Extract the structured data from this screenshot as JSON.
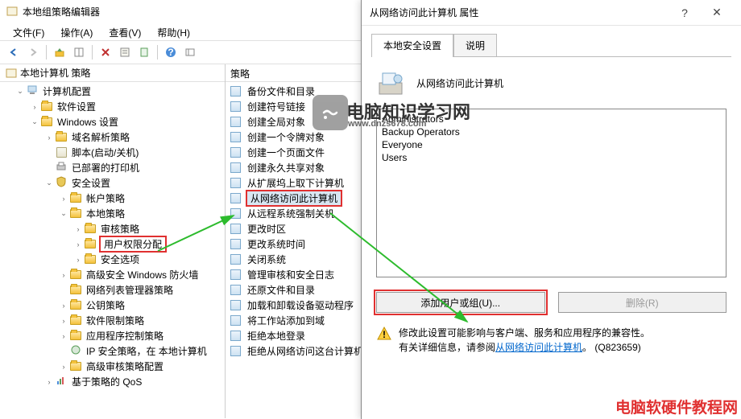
{
  "window": {
    "title": "本地组策略编辑器"
  },
  "menubar": {
    "file": "文件(F)",
    "action": "操作(A)",
    "view": "查看(V)",
    "help": "帮助(H)"
  },
  "tree": {
    "header": "本地计算机 策略",
    "nodes": [
      {
        "label": "计算机配置",
        "depth": 1,
        "expanded": true,
        "icon": "computer"
      },
      {
        "label": "软件设置",
        "depth": 2,
        "expanded": false,
        "icon": "folder"
      },
      {
        "label": "Windows 设置",
        "depth": 2,
        "expanded": true,
        "icon": "folder"
      },
      {
        "label": "域名解析策略",
        "depth": 3,
        "expanded": false,
        "icon": "folder"
      },
      {
        "label": "脚本(启动/关机)",
        "depth": 3,
        "expanded": null,
        "icon": "scroll"
      },
      {
        "label": "已部署的打印机",
        "depth": 3,
        "expanded": null,
        "icon": "printer"
      },
      {
        "label": "安全设置",
        "depth": 3,
        "expanded": true,
        "icon": "shield"
      },
      {
        "label": "帐户策略",
        "depth": 4,
        "expanded": false,
        "icon": "folder"
      },
      {
        "label": "本地策略",
        "depth": 4,
        "expanded": true,
        "icon": "folder"
      },
      {
        "label": "审核策略",
        "depth": 5,
        "expanded": false,
        "icon": "folder"
      },
      {
        "label": "用户权限分配",
        "depth": 5,
        "expanded": false,
        "icon": "folder",
        "highlight": true
      },
      {
        "label": "安全选项",
        "depth": 5,
        "expanded": false,
        "icon": "folder"
      },
      {
        "label": "高级安全 Windows 防火墙",
        "depth": 4,
        "expanded": false,
        "icon": "folder"
      },
      {
        "label": "网络列表管理器策略",
        "depth": 4,
        "expanded": null,
        "icon": "folder"
      },
      {
        "label": "公钥策略",
        "depth": 4,
        "expanded": false,
        "icon": "folder"
      },
      {
        "label": "软件限制策略",
        "depth": 4,
        "expanded": false,
        "icon": "folder"
      },
      {
        "label": "应用程序控制策略",
        "depth": 4,
        "expanded": false,
        "icon": "folder"
      },
      {
        "label": "IP 安全策略，在 本地计算机",
        "depth": 4,
        "expanded": null,
        "icon": "ipsec"
      },
      {
        "label": "高级审核策略配置",
        "depth": 4,
        "expanded": false,
        "icon": "folder"
      },
      {
        "label": "基于策略的 QoS",
        "depth": 3,
        "expanded": false,
        "icon": "qos"
      }
    ]
  },
  "list": {
    "header": "策略",
    "items": [
      "备份文件和目录",
      "创建符号链接",
      "创建全局对象",
      "创建一个令牌对象",
      "创建一个页面文件",
      "创建永久共享对象",
      "从扩展坞上取下计算机",
      "从网络访问此计算机",
      "从远程系统强制关机",
      "更改时区",
      "更改系统时间",
      "关闭系统",
      "管理审核和安全日志",
      "还原文件和目录",
      "加载和卸载设备驱动程序",
      "将工作站添加到域",
      "拒绝本地登录",
      "拒绝从网络访问这台计算机"
    ],
    "highlighted_index": 7
  },
  "dialog": {
    "title": "从网络访问此计算机 属性",
    "tabs": {
      "active": "本地安全设置",
      "inactive": "说明"
    },
    "heading": "从网络访问此计算机",
    "members": [
      "Administrators",
      "Backup Operators",
      "Everyone",
      "Users"
    ],
    "buttons": {
      "add": "添加用户或组(U)...",
      "remove": "删除(R)"
    },
    "warning_line1": "修改此设置可能影响与客户端、服务和应用程序的兼容性。",
    "warning_line2a": "有关详细信息，请参阅",
    "warning_link": "从网络访问此计算机",
    "warning_line2b": "。 (Q823659)"
  },
  "watermark": {
    "main": "电脑知识学习网",
    "sub": "www.dnzs678.com",
    "footer": "电脑软硬件教程网"
  }
}
